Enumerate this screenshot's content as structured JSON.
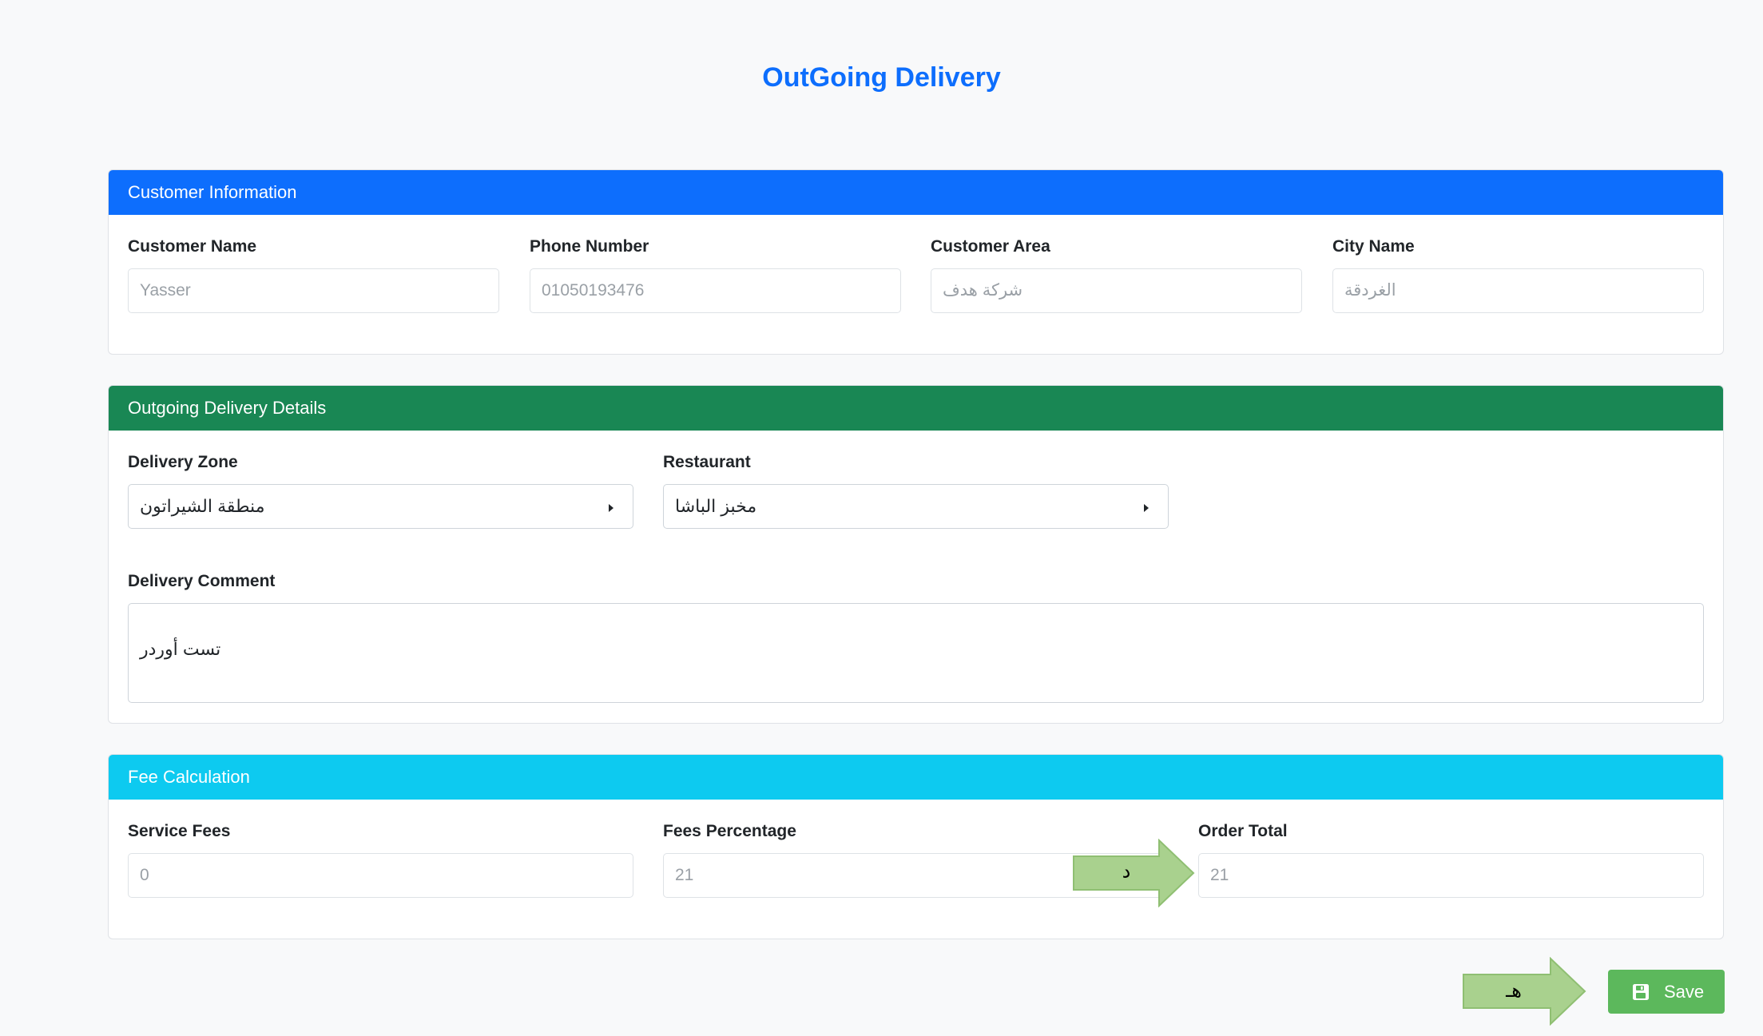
{
  "page": {
    "title": "OutGoing Delivery"
  },
  "customer_info": {
    "header": "Customer Information",
    "customer_name": {
      "label": "Customer Name",
      "value": "Yasser"
    },
    "phone_number": {
      "label": "Phone Number",
      "value": "01050193476"
    },
    "customer_area": {
      "label": "Customer Area",
      "value": "شركة هدف"
    },
    "city_name": {
      "label": "City Name",
      "value": "الغردقة"
    }
  },
  "delivery_details": {
    "header": "Outgoing Delivery Details",
    "delivery_zone": {
      "label": "Delivery Zone",
      "value": "منطقة الشيراتون"
    },
    "restaurant": {
      "label": "Restaurant",
      "value": "مخبز الباشا"
    },
    "delivery_comment": {
      "label": "Delivery Comment",
      "value": "تست أوردر"
    }
  },
  "fee_calculation": {
    "header": "Fee Calculation",
    "service_fees": {
      "label": "Service Fees",
      "value": "0"
    },
    "fees_percentage": {
      "label": "Fees Percentage",
      "value": "21"
    },
    "order_total": {
      "label": "Order Total",
      "value": "21"
    }
  },
  "actions": {
    "save_label": "Save",
    "save_icon": "floppy-disk-icon",
    "save_color": "#5cb85c"
  },
  "annotations": {
    "arrow_1_label": "د",
    "arrow_2_label": "هـ",
    "arrow_color": "#a9d18e"
  },
  "colors": {
    "primary": "#0d6efd",
    "success": "#198754",
    "info": "#0dcaf0"
  }
}
